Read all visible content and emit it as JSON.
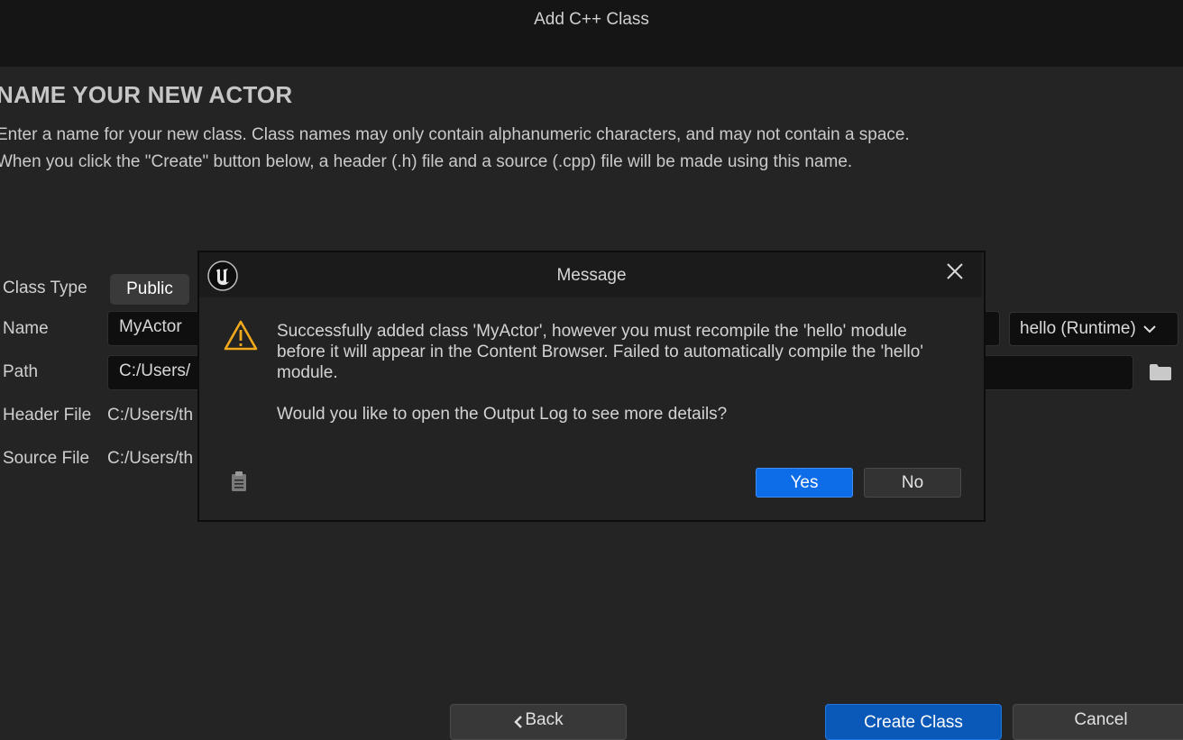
{
  "window": {
    "title": "Add C++ Class"
  },
  "page": {
    "heading": "NAME YOUR NEW ACTOR",
    "description_line1": "Enter a name for your new class. Class names may only contain alphanumeric characters, and may not contain a space.",
    "description_line2": "When you click the \"Create\" button below, a header (.h) file and a source (.cpp) file will be made using this name."
  },
  "form": {
    "class_type_label": "Class Type",
    "class_type_public": "Public",
    "name_label": "Name",
    "name_value": "MyActor",
    "module_value": "hello (Runtime)",
    "path_label": "Path",
    "path_value": "C:/Users/",
    "header_label": "Header File",
    "header_value": "C:/Users/th",
    "source_label": "Source File",
    "source_value": "C:/Users/th"
  },
  "buttons": {
    "back": "Back",
    "create": "Create Class",
    "cancel": "Cancel"
  },
  "dialog": {
    "title": "Message",
    "message_line1": "Successfully added class 'MyActor', however you must recompile the 'hello' module",
    "message_line2": "before it will appear in the Content Browser. Failed to automatically compile the 'hello'",
    "message_line3": "module.",
    "question": "Would you like to open the Output Log to see more details?",
    "yes": "Yes",
    "no": "No"
  },
  "colors": {
    "accent_blue": "#0d6ce8",
    "create_blue": "#0a59b8",
    "warning": "#f0a81c"
  }
}
